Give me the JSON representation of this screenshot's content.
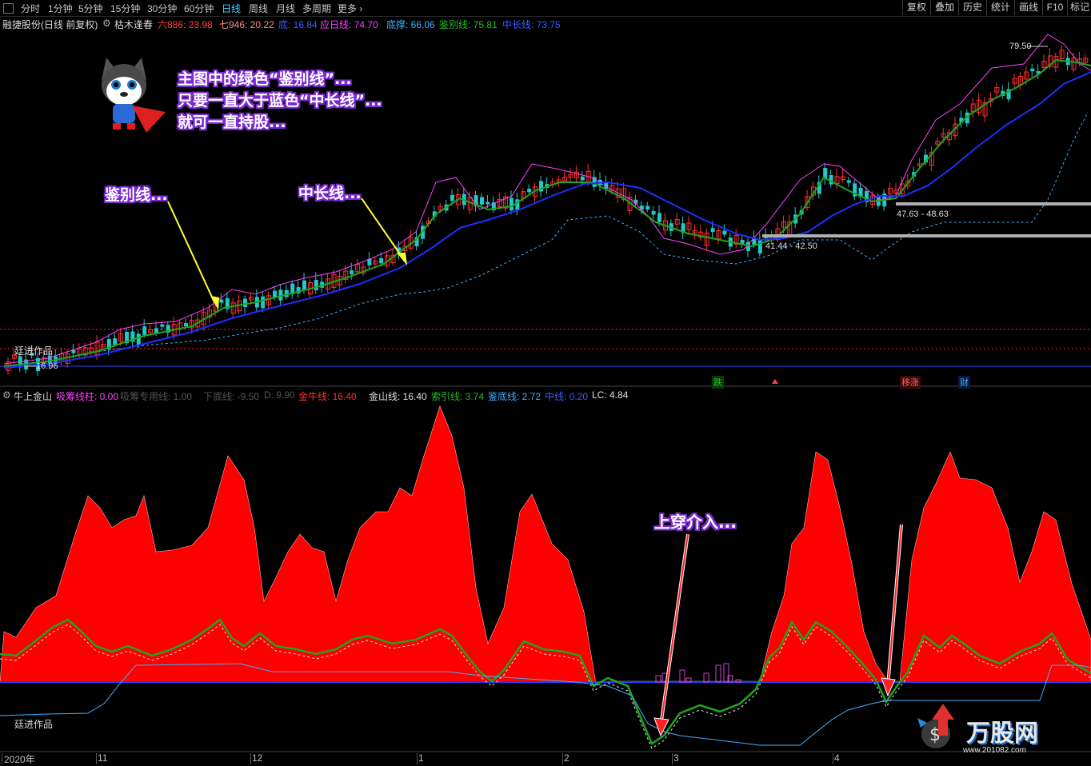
{
  "toolbar": {
    "periods": [
      "分时",
      "1分钟",
      "5分钟",
      "15分钟",
      "30分钟",
      "60分钟",
      "日线",
      "周线",
      "月线",
      "多周期",
      "更多"
    ],
    "active_period": "日线",
    "right_buttons": [
      "复权",
      "叠加",
      "历史",
      "统计",
      "画线",
      "F10",
      "标记"
    ]
  },
  "stock": {
    "name": "融捷股份(日线 前复权)",
    "indicator_name": "枯木逢春",
    "values": [
      {
        "label": "六886: 23.98",
        "color": "#ff4040"
      },
      {
        "label": "七946: 20.22",
        "color": "#ff8c8c"
      },
      {
        "label": "底: 16.84",
        "color": "#3a5bff"
      },
      {
        "label": "应日线: 74.70",
        "color": "#ff40ff"
      },
      {
        "label": "底撑: 66.06",
        "color": "#40b0ff"
      },
      {
        "label": "鉴别线: 75.81",
        "color": "#20c020"
      },
      {
        "label": "中长线: 73.75",
        "color": "#3a5bff"
      }
    ]
  },
  "indicator": {
    "name": "牛上金山",
    "values": [
      {
        "label": "吸筹线柱: 0.00",
        "color": "#ff40ff"
      },
      {
        "label": "吸筹专用线: 1.00",
        "color": "#555555"
      },
      {
        "label": "下底线: -9.50",
        "color": "#555555"
      },
      {
        "label": "D: 9.90",
        "color": "#555555"
      },
      {
        "label": "金牛线: 16.40",
        "color": "#ff3030"
      },
      {
        "label": "金山线: 16.40",
        "color": "#e0e0e0"
      },
      {
        "label": "索引线: 3.74",
        "color": "#20c020"
      },
      {
        "label": "鉴底线: 2.72",
        "color": "#40b0ff"
      },
      {
        "label": "中线: 0.20",
        "color": "#3a5bff"
      },
      {
        "label": "LC: 4.84",
        "color": "#e0e0e0"
      }
    ]
  },
  "annotations": {
    "main_text": [
      "主图中的绿色“鉴别线”...",
      "只要一直大于蓝色“中长线”...",
      "就可一直持股..."
    ],
    "arrow1": "鉴别线...",
    "arrow2": "中长线...",
    "cross": "上穿介入...",
    "watermark_top": "廷进作品",
    "watermark_bottom": "廷进作品",
    "logo": "万股网",
    "logo_url": "www.201082.com"
  },
  "price_labels": {
    "high": "79.50",
    "range1": "47.63 - 48.63",
    "range2": "41.44 - 42.50",
    "low": "16.96"
  },
  "signals": [
    {
      "label": "跌",
      "color": "#20c020",
      "bg": "#0a3a0a"
    },
    {
      "label": "移涨",
      "color": "#ff6060",
      "bg": "#3a0a0a"
    },
    {
      "label": "财",
      "color": "#40b0ff",
      "bg": "#0a1a3a"
    }
  ],
  "x_axis": [
    "2020年",
    "11",
    "12",
    "1",
    "2",
    "3",
    "4"
  ],
  "chart_data": {
    "type": "line",
    "x": [
      "2020年",
      "11",
      "12",
      "1",
      "2",
      "3",
      "4"
    ],
    "series": [
      {
        "name": "鉴别线",
        "values": []
      },
      {
        "name": "中长线",
        "values": []
      }
    ]
  },
  "colors": {
    "green_line": "#1fa51f",
    "blue_line": "#1f2fff",
    "red_fill": "#ff0000",
    "magenta": "#ff40ff",
    "cyan": "#40b0ff"
  }
}
